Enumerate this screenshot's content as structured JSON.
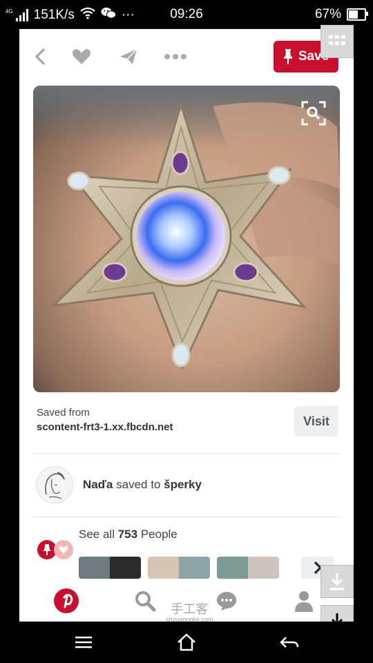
{
  "status": {
    "network": "4G",
    "speed": "151K/s",
    "more": "···",
    "time": "09:26",
    "battery_text": "67%",
    "battery_level": 0.67
  },
  "toolbar": {
    "save_label": "Save"
  },
  "pin": {
    "saved_from_label": "Saved from",
    "source_domain": "scontent-frt3-1.xx.fbcdn.net",
    "visit_label": "Visit"
  },
  "saver": {
    "name": "Naďa",
    "action": "saved to",
    "board": "šperky"
  },
  "people": {
    "prefix": "See all",
    "count": "753",
    "suffix": "People"
  },
  "tabbar": {
    "watermark_title": "手工客",
    "watermark_url": "shougongke.com"
  },
  "colors": {
    "brand": "#c8102e",
    "icon_gray": "#aaaaaa"
  },
  "icons": {
    "back": "chevron-left-icon",
    "like": "heart-icon",
    "send": "paper-plane-icon",
    "more": "more-dots-icon",
    "lens": "visual-search-icon",
    "home": "pinterest-logo-icon",
    "search": "search-icon",
    "messages": "chat-icon",
    "profile": "person-icon"
  }
}
